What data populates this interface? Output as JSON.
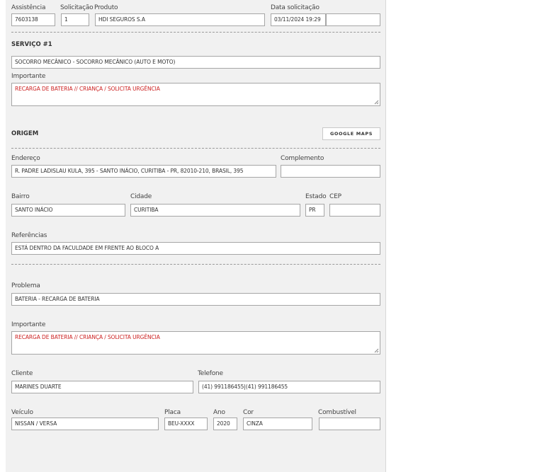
{
  "header": {
    "assistencia_label": "Assistência",
    "assistencia_value": "7603138",
    "solicitacao_label": "Solicitação",
    "solicitacao_value": "1",
    "produto_label": "Produto",
    "produto_value": "HDI SEGUROS S.A",
    "data_label": "Data solicitação",
    "data_value": "03/11/2024 19:29",
    "extra_value": ""
  },
  "servico": {
    "title": "SERVIÇO #1",
    "value": "SOCORRO MECÂNICO - SOCORRO MECÂNICO (AUTO E MOTO)",
    "importante_label": "Importante",
    "importante_value": "RECARGA DE BATERIA // CRIANÇA / SOLICITA URGÊNCIA"
  },
  "origem": {
    "title": "ORIGEM",
    "maps_button": "GOOGLE MAPS",
    "endereco_label": "Endereço",
    "endereco_value": "R. PADRE LADISLAU KULA, 395 - SANTO INÁCIO, CURITIBA - PR, 82010-210, BRASIL, 395",
    "complemento_label": "Complemento",
    "complemento_value": "",
    "bairro_label": "Bairro",
    "bairro_value": "SANTO INÁCIO",
    "cidade_label": "Cidade",
    "cidade_value": "CURITIBA",
    "estado_label": "Estado",
    "estado_value": "PR",
    "cep_label": "CEP",
    "cep_value": "",
    "referencias_label": "Referências",
    "referencias_value": "ESTÁ DENTRO DA FACULDADE EM FRENTE AO BLOCO A"
  },
  "problema": {
    "label": "Problema",
    "value": "BATERIA - RECARGA DE BATERIA",
    "importante_label": "Importante",
    "importante_value": "RECARGA DE BATERIA // CRIANÇA / SOLICITA URGÊNCIA"
  },
  "cliente": {
    "cliente_label": "Cliente",
    "cliente_value": "MARINES DUARTE",
    "telefone_label": "Telefone",
    "telefone_value": "(41) 991186455|(41) 991186455"
  },
  "veiculo": {
    "veiculo_label": "Veículo",
    "veiculo_value": "NISSAN / VERSA",
    "placa_label": "Placa",
    "placa_value": "BEU-XXXX",
    "ano_label": "Ano",
    "ano_value": "2020",
    "cor_label": "Cor",
    "cor_value": "CINZA",
    "combustivel_label": "Combustível",
    "combustivel_value": ""
  },
  "colors": {
    "panel_bg": "#f1f1f1",
    "field_border": "#a6a6a6",
    "important_text": "#cc2020"
  }
}
